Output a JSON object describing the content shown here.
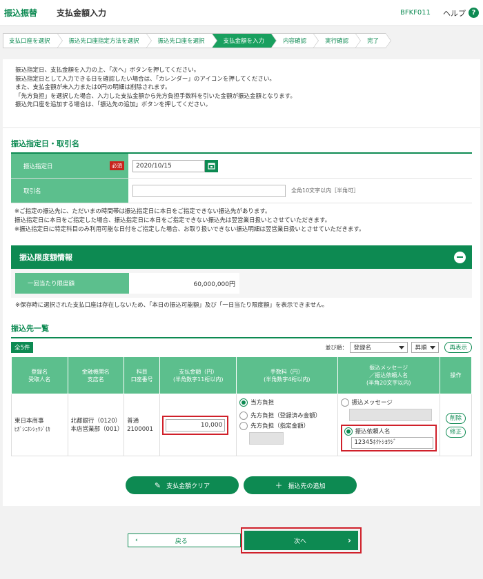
{
  "header": {
    "app_title": "振込振替",
    "page_title": "支払金額入力",
    "screen_id": "BFKF011",
    "help_label": "ヘルプ",
    "help_icon": "?"
  },
  "steps": [
    {
      "label": "支払口座を選択",
      "active": false
    },
    {
      "label": "振込先口座指定方法を選択",
      "active": false
    },
    {
      "label": "振込先口座を選択",
      "active": false
    },
    {
      "label": "支払金額を入力",
      "active": true
    },
    {
      "label": "内容確認",
      "active": false
    },
    {
      "label": "実行確認",
      "active": false
    },
    {
      "label": "完了",
      "active": false
    }
  ],
  "intro": {
    "lines": [
      "振込指定日、支払金額を入力の上、「次へ」ボタンを押してください。",
      "振込指定日として入力できる日を確認したい場合は、「カレンダー」のアイコンを押してください。",
      "また、支払金額が未入力または0円の明細は削除されます。",
      "「先方負担」を選択した場合、入力した支払金額から先方負担手数料を引いた金額が振込金額となります。",
      "振込先口座を追加する場合は、「振込先の追加」ボタンを押してください。"
    ]
  },
  "transfer_date_section": {
    "title": "振込指定日・取引名",
    "date_label": "振込指定日",
    "required_badge": "必須",
    "date_value": "2020/10/15",
    "trade_name_label": "取引名",
    "trade_name_value": "",
    "trade_name_hint": "全角10文字以内［半角可］",
    "notes": [
      "※ご指定の振込先に、ただいまの時間帯は振込指定日に本日をご指定できない振込先があります。",
      "振込指定日に本日をご指定した場合、振込指定日に本日をご指定できない振込先は翌営業日扱いとさせていただきます。",
      "※振込指定日に特定科目のみ利用可能な日付をご指定した場合、お取り扱いできない振込明細は翌営業日扱いとさせていただきます。"
    ]
  },
  "limit_section": {
    "title": "振込限度額情報",
    "row_label": "一回当たり限度額",
    "row_value": "60,000,000円",
    "note": "※保存時に選択された支払口座は存在しないため、「本日の振込可能額」及び「一日当たり限度額」を表示できません。"
  },
  "payee_section": {
    "title": "振込先一覧",
    "count_badge": "全5件",
    "sort_label": "並び順：",
    "sort_value": "登録名",
    "order_value": "昇順",
    "redisplay_label": "再表示",
    "headers": {
      "name_1": "登録名",
      "name_2": "受取人名",
      "bank_1": "金融機関名",
      "bank_2": "支店名",
      "account_1": "科目",
      "account_2": "口座番号",
      "amount_1": "支払金額（円）",
      "amount_2": "(半角数字11桁以内)",
      "fee_1": "手数料（円）",
      "fee_2": "(半角数字4桁以内)",
      "msg_1": "振込メッセージ",
      "msg_2": "／振込依頼人名",
      "msg_3": "(半角20文字以内)",
      "op": "操作"
    },
    "row": {
      "reg_name": "東日本商事",
      "payee_name": "ﾋｶﾞｼﾆﾎﾝｼｮｳｼﾞ(ｶ",
      "bank_name": "北都銀行（0120）",
      "branch_name": "本店営業部（001）",
      "account_type": "普通",
      "account_no": "2100001",
      "amount": "10,000",
      "fee_option_1": "当方負担",
      "fee_option_2": "先方負担（登録済み金額）",
      "fee_option_3": "先方負担（指定金額）",
      "fee_selected": 1,
      "msg_option_1": "振込メッセージ",
      "msg_option_2": "振込依頼人名",
      "msg_selected": 2,
      "requester_name": "12345ﾎｸﾄｼﾖｳｼﾞ",
      "delete_label": "削除",
      "edit_label": "修正"
    },
    "clear_button": "支払金額クリア",
    "add_button": "振込先の追加"
  },
  "footer": {
    "back_label": "戻る",
    "next_label": "次へ"
  },
  "colors": {
    "brand_green": "#0d8a52",
    "label_green": "#5cbf8d",
    "highlight_red": "#d0202a",
    "required_red": "#c8241c"
  }
}
